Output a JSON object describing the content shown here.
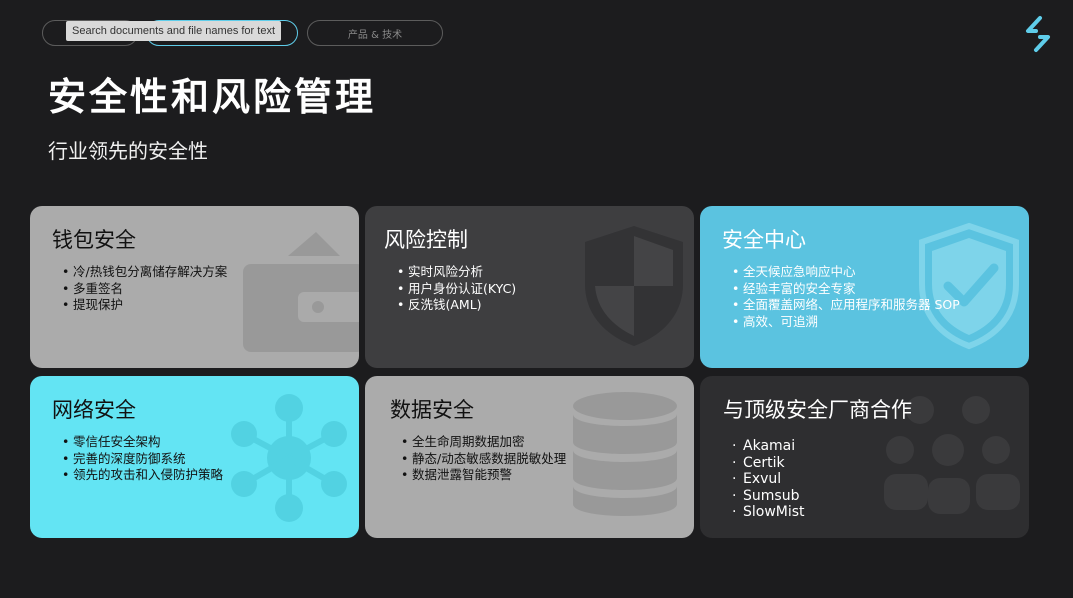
{
  "nav": {
    "search_tooltip": "Search documents and file names for text",
    "tabs": [
      "",
      "",
      "产品 & 技术"
    ]
  },
  "header": {
    "title": "安全性和风险管理",
    "subtitle": "行业领先的安全性"
  },
  "cards": [
    {
      "title": "钱包安全",
      "items": [
        "冷/热钱包分离储存解决方案",
        "多重签名",
        "提现保护"
      ]
    },
    {
      "title": "风险控制",
      "items": [
        "实时风险分析",
        "用户身份认证(KYC)",
        "反洗钱(AML)"
      ]
    },
    {
      "title": "安全中心",
      "items": [
        "全天候应急响应中心",
        "经验丰富的安全专家",
        "全面覆盖网络、应用程序和服务器 SOP",
        "高效、可追溯"
      ]
    },
    {
      "title": "网络安全",
      "items": [
        "零信任安全架构",
        "完善的深度防御系统",
        "领先的攻击和入侵防护策略"
      ]
    },
    {
      "title": "数据安全",
      "items": [
        "全生命周期数据加密",
        "静态/动态敏感数据脱敏处理",
        "数据泄露智能预警"
      ]
    },
    {
      "title": "与顶级安全厂商合作",
      "items": [
        "Akamai",
        "Certik",
        "Exvul",
        "Sumsub",
        "SlowMist"
      ]
    }
  ],
  "icons": {
    "wallet": "wallet-icon",
    "shield": "shield-icon",
    "shield_check": "shield-check-icon",
    "network": "network-icon",
    "database": "database-icon",
    "group": "group-icon",
    "logo": "logo-icon"
  },
  "colors": {
    "background": "#1c1c1e",
    "accent": "#5fcdea",
    "card_gray": "#ababab",
    "card_dark": "#3e3e40",
    "card_blue": "#5bc3e0",
    "card_cyan": "#63e4f3",
    "card_darkest": "#2e2e30"
  }
}
